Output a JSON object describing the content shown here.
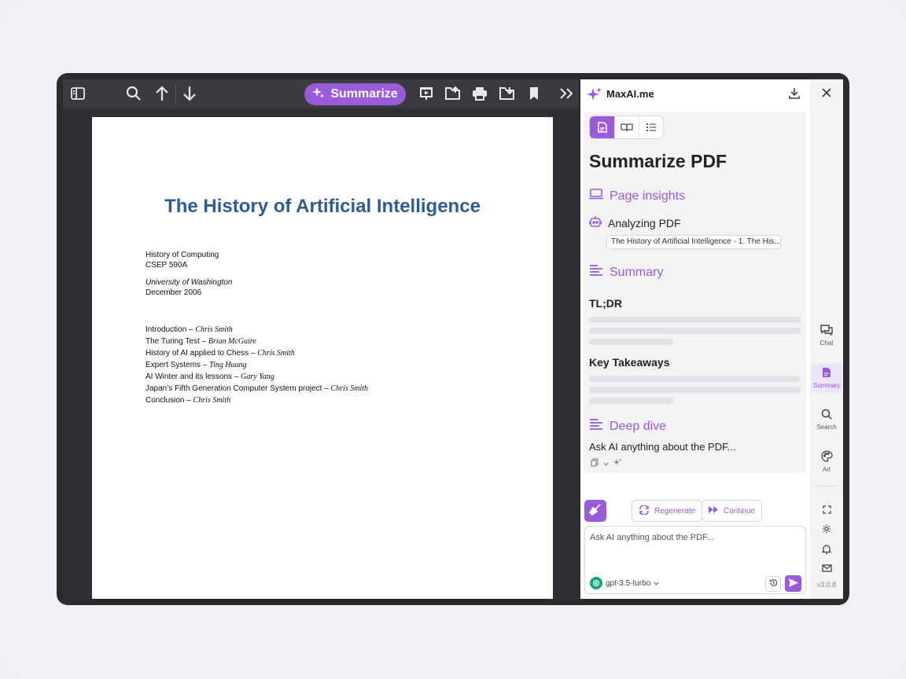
{
  "toolbar": {
    "summarize_label": "Summarize"
  },
  "document": {
    "title": "The History of Artificial Intelligence",
    "course": "History of Computing",
    "course_code": "CSEP 590A",
    "university": "University of Washington",
    "date": "December 2006",
    "toc": [
      {
        "topic": "Introduction – ",
        "author": "Chris Smith"
      },
      {
        "topic": "The Turing Test – ",
        "author": "Brian McGuire"
      },
      {
        "topic": "History of AI applied to Chess – ",
        "author": "Chris Smith"
      },
      {
        "topic": "Expert Systems – ",
        "author": "Ting Huang"
      },
      {
        "topic": "AI Winter and its lessons – ",
        "author": "Gary Yang"
      },
      {
        "topic": "Japan’s Fifth Generation Computer System project – ",
        "author": "Chris Smith"
      },
      {
        "topic": "Conclusion – ",
        "author": "Chris Smith"
      }
    ]
  },
  "panel": {
    "brand": "MaxAI.me",
    "heading": "Summarize PDF",
    "page_insights": "Page insights",
    "analyzing": "Analyzing PDF",
    "chip": "The History of Artificial Intelligence - 1. The His...",
    "summary": "Summary",
    "tldr": "TL;DR",
    "key_takeaways": "Key Takeaways",
    "deep_dive": "Deep dive",
    "deep_dive_text": "Ask AI anything about the PDF...",
    "regenerate": "Regenerate",
    "continue": "Continue",
    "input_placeholder": "Ask AI anything about the PDF...",
    "model": "gpt-3.5-turbo"
  },
  "rail": {
    "chat": "Chat",
    "summary": "Summary",
    "search": "Search",
    "art": "Art",
    "version": "v3.0.8"
  },
  "colors": {
    "accent": "#9a5bd9",
    "doc_title": "#2f5b94",
    "toolbar": "#3a3b3e"
  }
}
